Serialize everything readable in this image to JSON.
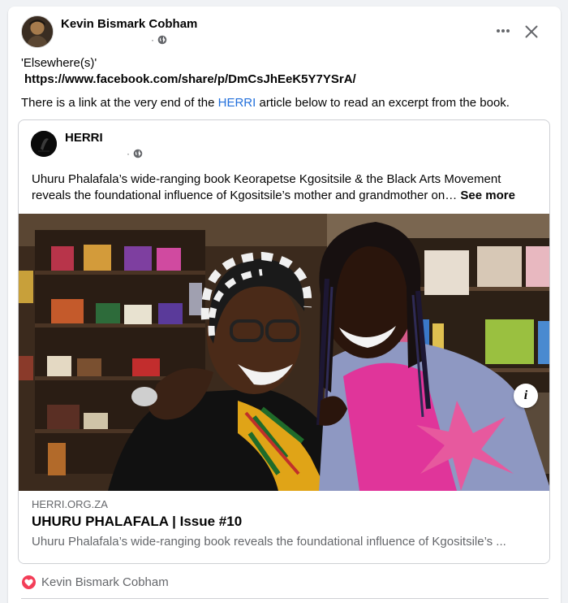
{
  "post": {
    "author": "Kevin Bismark Cobham",
    "meta_separator": "·",
    "text_line1": "'Elsewhere(s)'",
    "text_line2": "https://www.facebook.com/share/p/DmCsJhEeK5Y7YSrA/",
    "text_line3_before": "There is a link at the very end of the ",
    "text_line3_link": "HERRI",
    "text_line3_after": " article below to read an excerpt from the book."
  },
  "shared": {
    "author": "HERRI",
    "meta_separator": "·",
    "text_line1": "Uhuru Phalafala’s wide-ranging book Keorapetse Kgositsile & the Black Arts Movement",
    "text_line2": "reveals the foundational influence of Kgositsile’s mother and grandmother on…",
    "see_more": "See more",
    "link": {
      "domain": "HERRI.ORG.ZA",
      "title": "UHURU PHALAFALA | Issue #10",
      "description": "Uhuru Phalafala’s wide-ranging book reveals the foundational influence of Kgositsile’s ..."
    }
  },
  "reactions": {
    "name": "Kevin Bismark Cobham"
  },
  "colors": {
    "link": "#216fdb",
    "heart": "#f33e58",
    "secondary_text": "#65676b"
  },
  "icons": [
    "more-icon",
    "close-icon",
    "globe-icon",
    "info-icon",
    "heart-icon"
  ]
}
